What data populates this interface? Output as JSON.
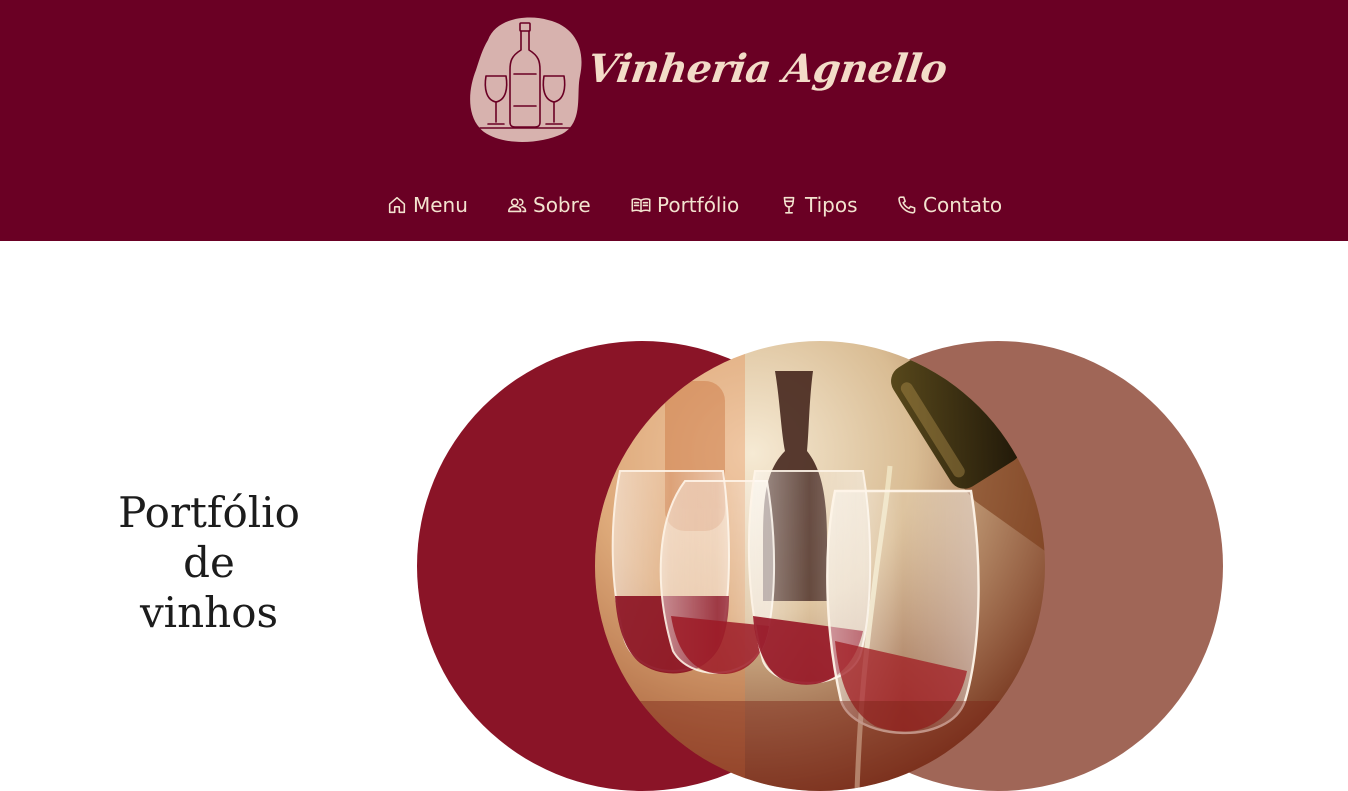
{
  "brand": {
    "name": "Vinheria Agnello",
    "colors": {
      "header_bg": "#6a0024",
      "text_light": "#f3e3cf",
      "circle_left": "#8a1427",
      "circle_right": "#a06657"
    }
  },
  "nav": {
    "items": [
      {
        "label": "Menu",
        "icon": "home-icon"
      },
      {
        "label": "Sobre",
        "icon": "users-icon"
      },
      {
        "label": "Portfólio",
        "icon": "book-open-icon"
      },
      {
        "label": "Tipos",
        "icon": "wine-glass-icon"
      },
      {
        "label": "Contato",
        "icon": "phone-icon"
      }
    ]
  },
  "hero": {
    "title_lines": [
      "Portfólio",
      "de",
      "vinhos"
    ]
  }
}
